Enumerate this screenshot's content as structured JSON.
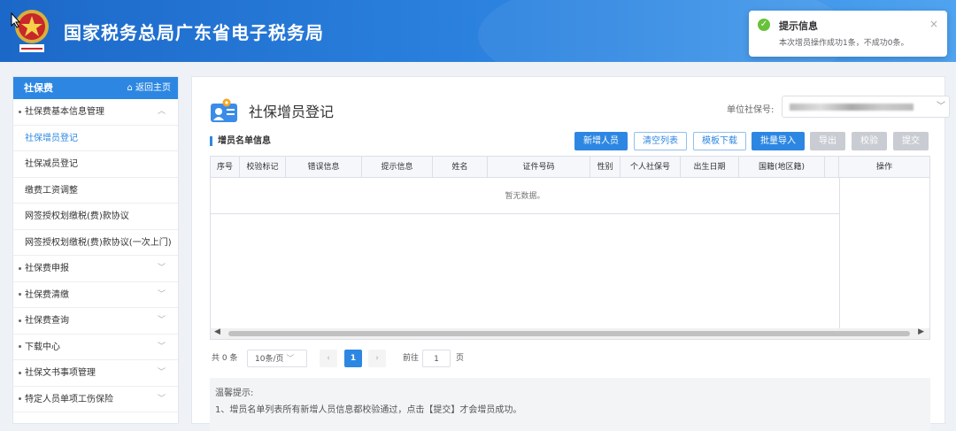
{
  "header": {
    "title": "国家税务总局广东省电子税务局"
  },
  "toast": {
    "title": "提示信息",
    "message": "本次增员操作成功1条，不成功0条。",
    "close": "×"
  },
  "sidebar": {
    "title": "社保费",
    "home": "返回主页",
    "items": [
      {
        "label": "社保费基本信息管理",
        "type": "group",
        "expanded": true
      },
      {
        "label": "社保增员登记",
        "type": "sub",
        "active": true
      },
      {
        "label": "社保减员登记",
        "type": "sub"
      },
      {
        "label": "缴费工资调整",
        "type": "sub"
      },
      {
        "label": "网签授权划缴税(费)款协议",
        "type": "sub"
      },
      {
        "label": "网签授权划缴税(费)款协议(一次上门)",
        "type": "sub"
      },
      {
        "label": "社保费申报",
        "type": "group"
      },
      {
        "label": "社保费清缴",
        "type": "group"
      },
      {
        "label": "社保费查询",
        "type": "group"
      },
      {
        "label": "下载中心",
        "type": "group"
      },
      {
        "label": "社保文书事项管理",
        "type": "group"
      },
      {
        "label": "特定人员单项工伤保险",
        "type": "group"
      }
    ]
  },
  "page": {
    "title": "社保增员登记",
    "unit_label": "单位社保号:",
    "section_title": "增员名单信息",
    "buttons": {
      "add": "新增人员",
      "clear": "清空列表",
      "template": "模板下载",
      "import": "批量导入",
      "export": "导出",
      "verify": "校验",
      "submit": "提交"
    },
    "table": {
      "columns": [
        "序号",
        "校验标记",
        "错误信息",
        "提示信息",
        "姓名",
        "证件号码",
        "性别",
        "个人社保号",
        "出生日期",
        "国籍(地区籍)",
        "操作"
      ],
      "empty_text": "暂无数据。"
    },
    "pager": {
      "total": "共 0 条",
      "page_size": "10条/页",
      "current": "1",
      "goto_label": "前往",
      "goto_value": "1",
      "page_unit": "页"
    },
    "tips": {
      "title": "温馨提示:",
      "line1": "1、增员名单列表所有新增人员信息都校验通过，点击【提交】才会增员成功。"
    }
  },
  "colors": {
    "primary": "#2d87e2",
    "success": "#67c23a",
    "disabled": "#c9ccd2"
  }
}
